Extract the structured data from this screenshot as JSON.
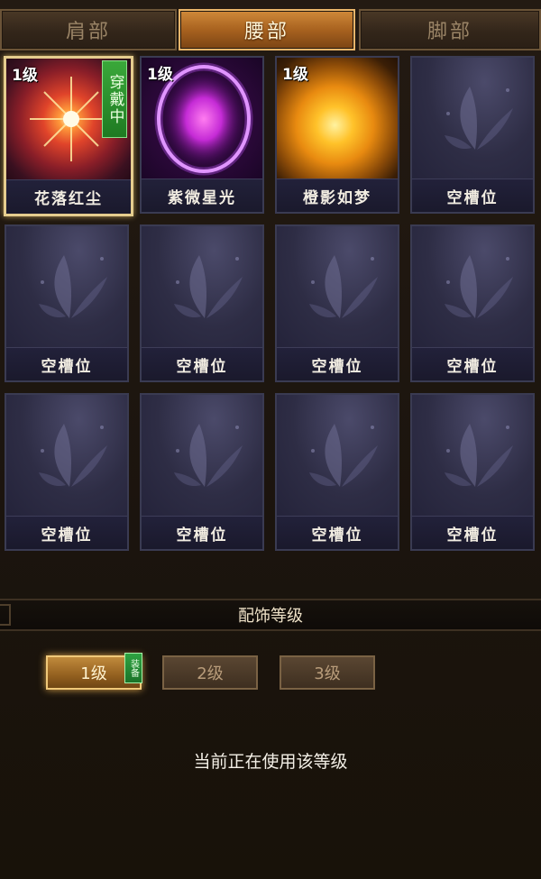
{
  "tabs": [
    {
      "label": "肩部",
      "active": false
    },
    {
      "label": "腰部",
      "active": true
    },
    {
      "label": "脚部",
      "active": false
    }
  ],
  "slots": [
    {
      "name": "花落红尘",
      "level": "1级",
      "wearing": "穿戴中",
      "icon": "red-starburst-icon",
      "color": "#e04a28"
    },
    {
      "name": "紫微星光",
      "level": "1级",
      "icon": "purple-ring-icon",
      "color": "#c52bd6"
    },
    {
      "name": "橙影如梦",
      "level": "1级",
      "icon": "orange-sun-icon",
      "color": "#f0a21c"
    },
    {
      "name": "空槽位",
      "icon": "butterfly-icon"
    },
    {
      "name": "空槽位",
      "icon": "butterfly-icon"
    },
    {
      "name": "空槽位",
      "icon": "butterfly-icon"
    },
    {
      "name": "空槽位",
      "icon": "butterfly-icon"
    },
    {
      "name": "空槽位",
      "icon": "butterfly-icon"
    },
    {
      "name": "空槽位",
      "icon": "butterfly-icon"
    },
    {
      "name": "空槽位",
      "icon": "butterfly-icon"
    },
    {
      "name": "空槽位",
      "icon": "butterfly-icon"
    },
    {
      "name": "空槽位",
      "icon": "butterfly-icon"
    }
  ],
  "section": {
    "title": "配饰等级"
  },
  "levels": [
    {
      "label": "1级",
      "active": true,
      "tag": "装备"
    },
    {
      "label": "2级",
      "active": false
    },
    {
      "label": "3级",
      "active": false
    }
  ],
  "status": "当前正在使用该等级",
  "colors": {
    "accent": "#d08a3a",
    "equip_green": "#2fa342",
    "slot_border": "#3a3b52"
  }
}
